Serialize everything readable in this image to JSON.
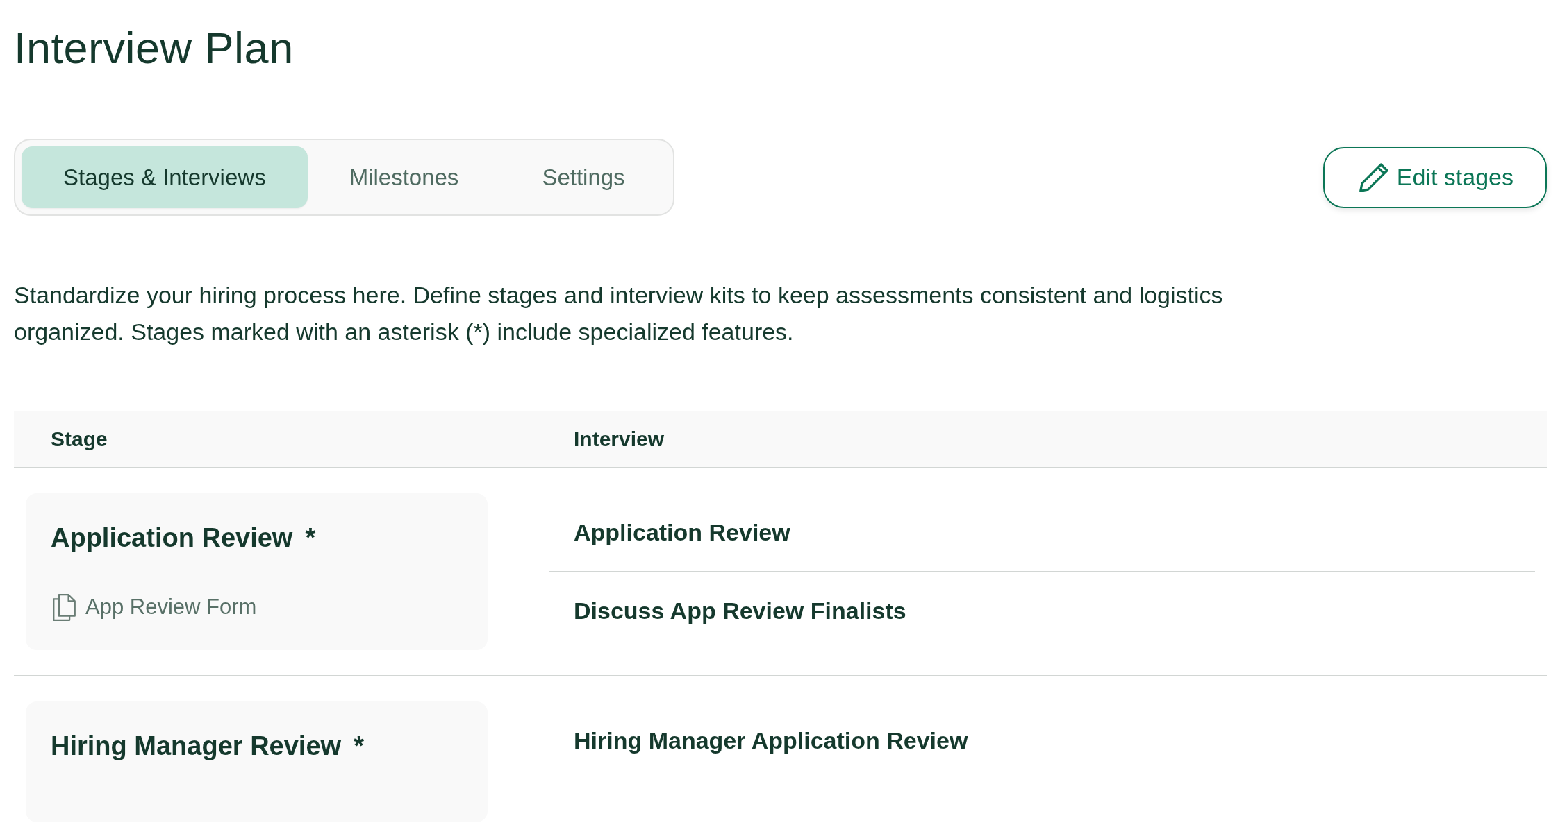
{
  "page": {
    "title": "Interview Plan"
  },
  "tabs": [
    {
      "label": "Stages & Interviews",
      "selected": true
    },
    {
      "label": "Milestones",
      "selected": false
    },
    {
      "label": "Settings",
      "selected": false
    }
  ],
  "edit_button": {
    "label": "Edit stages"
  },
  "description": "Standardize your hiring process here. Define stages and interview kits to keep assessments consistent and logistics organized. Stages marked with an asterisk (*) include specialized features.",
  "table": {
    "columns": [
      "Stage",
      "Interview"
    ],
    "rows": [
      {
        "stage": {
          "name": "Application Review",
          "marker": "*",
          "forms": [
            "App Review Form"
          ]
        },
        "interviews": [
          "Application Review",
          "Discuss App Review Finalists"
        ]
      },
      {
        "stage": {
          "name": "Hiring Manager Review",
          "marker": "*"
        },
        "interviews": [
          "Hiring Manager Application Review"
        ]
      }
    ]
  }
}
